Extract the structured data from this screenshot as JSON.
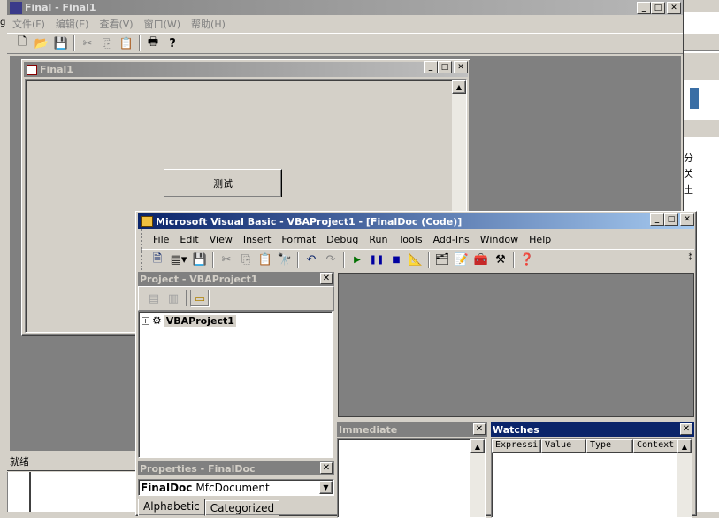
{
  "main_window": {
    "title": "Final - Final1",
    "menu": [
      {
        "label": "文件(F)"
      },
      {
        "label": "编辑(E)"
      },
      {
        "label": "查看(V)"
      },
      {
        "label": "窗口(W)"
      },
      {
        "label": "帮助(H)"
      }
    ],
    "status_text": "就绪",
    "left_edge_glyph": "g"
  },
  "child_window": {
    "title": "Final1",
    "button_label": "测试"
  },
  "vb_window": {
    "title": "Microsoft Visual Basic - VBAProject1 - [FinalDoc (Code)]",
    "menu": [
      {
        "label": "File"
      },
      {
        "label": "Edit"
      },
      {
        "label": "View"
      },
      {
        "label": "Insert"
      },
      {
        "label": "Format"
      },
      {
        "label": "Debug"
      },
      {
        "label": "Run"
      },
      {
        "label": "Tools"
      },
      {
        "label": "Add-Ins"
      },
      {
        "label": "Window"
      },
      {
        "label": "Help"
      }
    ],
    "project_pane": {
      "title": "Project - VBAProject1",
      "tree_root": "VBAProject1"
    },
    "properties_pane": {
      "title": "Properties - FinalDoc",
      "object_name": "FinalDoc",
      "object_type": "MfcDocument",
      "tabs": [
        {
          "label": "Alphabetic"
        },
        {
          "label": "Categorized"
        }
      ]
    },
    "immediate_pane": {
      "title": "Immediate"
    },
    "watches_pane": {
      "title": "Watches",
      "columns": [
        {
          "label": "Expressi"
        },
        {
          "label": "Value"
        },
        {
          "label": "Type"
        },
        {
          "label": "Context"
        }
      ]
    }
  },
  "bg_window": {
    "side_glyphs": "分\n关\n土"
  },
  "colors": {
    "active_caption": "#0a246a",
    "inactive_caption": "#808080",
    "mdi_background": "#808080",
    "face": "#d4d0c8"
  }
}
